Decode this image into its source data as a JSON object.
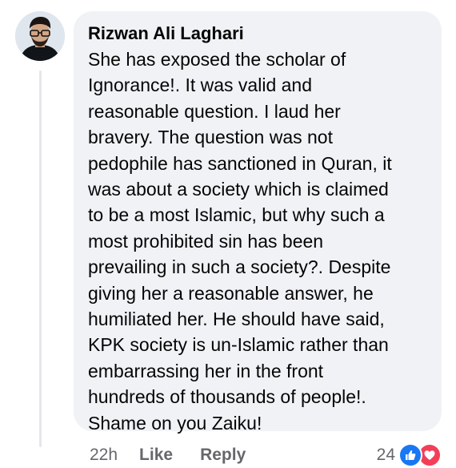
{
  "comment": {
    "author": "Rizwan Ali Laghari",
    "text": "She has exposed the scholar of\nIgnorance!. It was valid and\nreasonable question. I laud her\nbravery. The question was not\npedophile has sanctioned in Quran, it\nwas about a society which is claimed\nto be a most Islamic, but why such a\nmost prohibited sin has been\nprevailing in such a society?. Despite\ngiving her a reasonable answer, he\nhumiliated her. He should have said,\nKPK society is un-Islamic rather than\nembarrassing her in the front\nhundreds of thousands of people!.\nShame on you Zaiku!"
  },
  "actions": {
    "timestamp": "22h",
    "like_label": "Like",
    "reply_label": "Reply"
  },
  "reactions": {
    "count": "24",
    "icons": [
      "like-icon",
      "love-icon"
    ],
    "like_color": "#1877f2",
    "love_color": "#f33e58"
  },
  "colors": {
    "bubble_bg": "#f0f2f5",
    "text": "#050505",
    "secondary_text": "#65676b"
  }
}
